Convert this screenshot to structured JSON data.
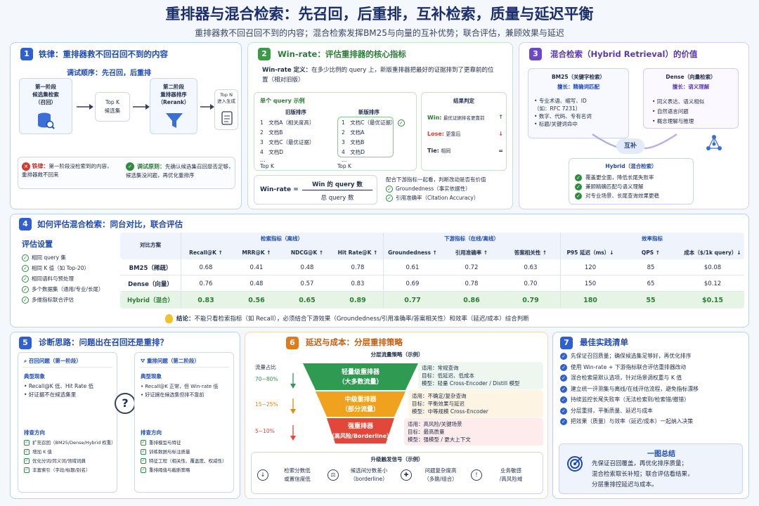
{
  "header": {
    "title": "重排器与混合检索：先召回，后重排，互补检索，质量与延迟平衡",
    "subtitle": "重排器救不回召回不到的内容；混合检索发挥BM25与向量的互补优势；联合评估，兼顾效果与延迟"
  },
  "s1": {
    "num": "1",
    "title": "铁律：重排器救不回召回不到的内容",
    "sub": "调试顺序：先召回，后重排",
    "stage1": "第一阶段\n候选集检索\n（召回）",
    "topk": "Top K\n候选集",
    "stage2": "第二阶段\n重排器排序\n（Rerank）",
    "topn": "Top N\n进入生成",
    "rule_label": "铁律：",
    "rule_text": "第一阶段没检索到的内容，\n重排器救不回来",
    "principle_label": "调试原则：",
    "principle_text": "先确认候选集召回是否足够，\n候选集没问题，再优化重排序"
  },
  "s2": {
    "num": "2",
    "title": "Win-rate：评估重排器的核心指标",
    "def_label": "Win-rate 定义：",
    "def_text": "在多少比例的 query 上，新版重排器把最好的证据排到了更靠前的位置（相对旧版）",
    "example_title": "单个 query 示例",
    "old_title": "旧版排序",
    "new_title": "新版排序",
    "old": [
      "1　文档A（相关度高）",
      "2　文档B",
      "3　文档C（最优证据）",
      "4　文档D",
      "…"
    ],
    "new": [
      "1　文档C（最优证据）",
      "2　文档A",
      "3　文档B",
      "4　文档D",
      "…"
    ],
    "topk": "Top K",
    "result_title": "结果判定",
    "win": "Win:",
    "win_text": "最优证据排名更靠前",
    "lose": "Lose:",
    "lose_text": "更靠后",
    "tie": "Tie:",
    "tie_text": "相同",
    "formula_lhs": "Win-rate =",
    "formula_num": "Win 的 query 数",
    "formula_den": "总 query 数",
    "combine": "配合下游指标一起看，判断改动是否有价值",
    "combine_items": [
      "Groundedness（事实依据性）",
      "引用准确率（Citation Accuracy）"
    ]
  },
  "s3": {
    "num": "3",
    "title": "混合检索（Hybrid Retrieval）的价值",
    "bm25_title": "BM25（关键字检索）",
    "bm25_sub": "擅长：精确词匹配",
    "bm25_items": [
      "专业术语、缩写、ID\n（如：RFC 7231）",
      "数字、代码、专有名词",
      "标题/关键词命中"
    ],
    "dense_title": "Dense（向量检索）",
    "dense_sub": "擅长：语义理解",
    "dense_items": [
      "同义表达、语义相似",
      "自然语言问题",
      "概念理解与推理"
    ],
    "complement": "互补",
    "hybrid_title": "Hybrid（混合检索）",
    "hybrid_items": [
      "覆盖更全面，降低长尾失败率",
      "兼顾精确匹配与语义理解",
      "对专业场景、长尾查询效果更稳"
    ]
  },
  "s4": {
    "num": "4",
    "title": "如何评估混合检索：同台对比，联合评估",
    "settings_title": "评估设置",
    "settings": [
      "相同 query 集",
      "相同 K 值（如 Top-20）",
      "相同语料与预处理",
      "多个数据集（通用/专业/长尾）",
      "多维指标联合评估"
    ],
    "groups": [
      "对比方案",
      "检索指标（离线）",
      "下游指标（在线/离线）",
      "效率指标"
    ],
    "cols": [
      "Recall@K ↑",
      "MRR@K ↑",
      "NDCG@K ↑",
      "Hit Rate@K ↑",
      "Groundedness ↑",
      "引用准确率 ↑",
      "答案相关性 ↑",
      "P95 延迟（ms）↓",
      "QPS ↑",
      "成本（$/1k query）↓"
    ],
    "rows": [
      {
        "name": "BM25（稀疏）",
        "vals": [
          "0.68",
          "0.41",
          "0.48",
          "0.78",
          "0.61",
          "0.72",
          "0.63",
          "120",
          "85",
          "$0.08"
        ]
      },
      {
        "name": "Dense（向量）",
        "vals": [
          "0.76",
          "0.48",
          "0.57",
          "0.83",
          "0.69",
          "0.78",
          "0.70",
          "150",
          "65",
          "$0.12"
        ]
      },
      {
        "name": "Hybrid（混合）",
        "vals": [
          "0.83",
          "0.56",
          "0.65",
          "0.89",
          "0.77",
          "0.86",
          "0.79",
          "180",
          "55",
          "$0.15"
        ]
      }
    ],
    "conclusion_label": "结论：",
    "conclusion": "不能只看检索指标（如 Recall），必须结合下游效果（Groundedness/引用准确率/答案相关性）和效率（延迟/成本）综合判断"
  },
  "s5": {
    "num": "5",
    "title": "诊断思路：问题出在召回还是重排？",
    "left_title": "召回问题（第一阶段）",
    "right_title": "重排问题（第二阶段）",
    "phen": "典型现象",
    "left_phen": [
      "Recall@K 低、Hit Rate 低",
      "好证据不在候选集里"
    ],
    "right_phen": [
      "Recall@K 正常，但 Win-rate 低",
      "好证据在候选集但排不靠前"
    ],
    "check": "排查方向",
    "left_check": [
      "扩充召回（BM25/Dense/Hybrid 权重）",
      "增加 K 值",
      "优化分词/同义词/领域词典",
      "丰富索引（字段/标题/别名）"
    ],
    "right_check": [
      "重排模型与特征",
      "训练数据与标注质量",
      "特征工程（相关性、覆盖度、权威性）",
      "重排阈值与截断策略"
    ],
    "q": "?"
  },
  "s6": {
    "num": "6",
    "title": "延迟与成本：分层重排策略",
    "strategy_title": "分层流量策略（示例）",
    "share_label": "流量占比",
    "tiers": [
      {
        "pct": "70~80%",
        "name": "轻量级重排器",
        "sub": "（大多数流量）",
        "use": "适用：常规查询",
        "goal": "目标：低延迟、低成本",
        "model": "模型：轻量 Cross-Encoder / Distill 模型"
      },
      {
        "pct": "15~25%",
        "name": "中级重排器",
        "sub": "（部分流量）",
        "use": "适用：不确定/复杂查询",
        "goal": "目标：平衡效果与延迟",
        "model": "模型：中等规模 Cross-Encoder"
      },
      {
        "pct": "5~10%",
        "name": "强重排器",
        "sub": "（高风险/Borderline）",
        "use": "适用：高风险/关键场景",
        "goal": "目标：最高质量",
        "model": "模型：强模型 / 更大上下文"
      }
    ],
    "upgrade_title": "升级触发信号（示例）",
    "signals": [
      "检索分数低\n或置信度低",
      "候选间分数差小\n（borderline）",
      "问题复杂度高\n（多跳/组合）",
      "业务敏感\n/高风险域"
    ],
    "colors": {
      "light": "#2f9a52",
      "mid": "#f0a21e",
      "strong": "#e2483a"
    }
  },
  "s7": {
    "num": "7",
    "title": "最佳实践清单",
    "items": [
      "先保证召回质量；确保候选集足够好，再优化排序",
      "使用 Win-rate + 下游指标联合评估重排器改动",
      "混合检索是默认选项，针对场景调权重与 K 值",
      "建立统一评测集与离线/在线评估流程，避免指标漂移",
      "持续监控长尾失败率（无法检索到/检索错/撤错）",
      "分层重排，平衡质量、延迟与成本",
      "把效果（质量）与效率（延迟/成本）一起纳入决策"
    ],
    "summary_title": "一图总结",
    "summary_text": "先保证召回覆盖，再优化排序质量；\n混合检索取长补短；联合评估看结果，\n分层重排控延迟与成本。"
  }
}
